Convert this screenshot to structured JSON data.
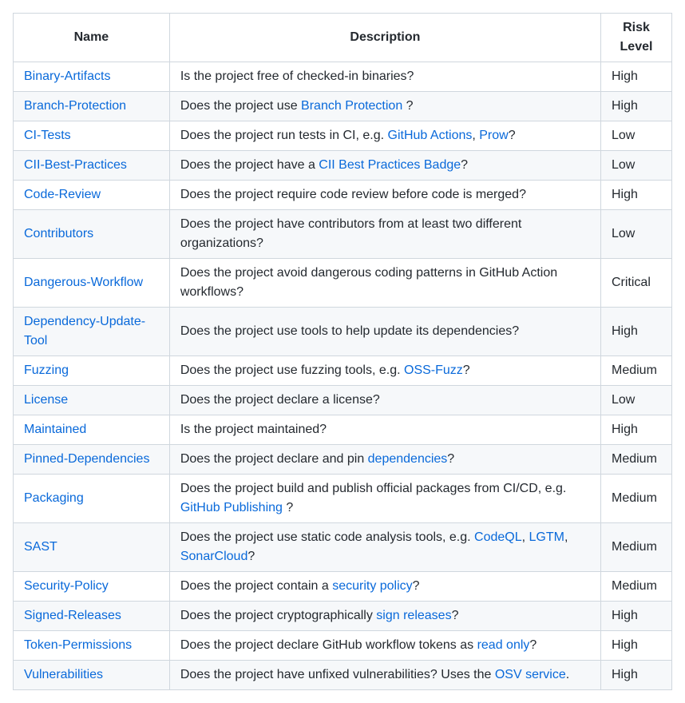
{
  "headers": {
    "name": "Name",
    "description": "Description",
    "risk": "Risk Level"
  },
  "rows": [
    {
      "name": "Binary-Artifacts",
      "desc": [
        {
          "t": "text",
          "v": "Is the project free of checked-in binaries?"
        }
      ],
      "risk": "High"
    },
    {
      "name": "Branch-Protection",
      "desc": [
        {
          "t": "text",
          "v": "Does the project use "
        },
        {
          "t": "link",
          "v": "Branch Protection"
        },
        {
          "t": "text",
          "v": " ?"
        }
      ],
      "risk": "High"
    },
    {
      "name": "CI-Tests",
      "desc": [
        {
          "t": "text",
          "v": "Does the project run tests in CI, e.g. "
        },
        {
          "t": "link",
          "v": "GitHub Actions"
        },
        {
          "t": "text",
          "v": ", "
        },
        {
          "t": "link",
          "v": "Prow"
        },
        {
          "t": "text",
          "v": "?"
        }
      ],
      "risk": "Low"
    },
    {
      "name": "CII-Best-Practices",
      "desc": [
        {
          "t": "text",
          "v": "Does the project have a "
        },
        {
          "t": "link",
          "v": "CII Best Practices Badge"
        },
        {
          "t": "text",
          "v": "?"
        }
      ],
      "risk": "Low"
    },
    {
      "name": "Code-Review",
      "desc": [
        {
          "t": "text",
          "v": "Does the project require code review before code is merged?"
        }
      ],
      "risk": "High"
    },
    {
      "name": "Contributors",
      "desc": [
        {
          "t": "text",
          "v": "Does the project have contributors from at least two different organizations?"
        }
      ],
      "risk": "Low"
    },
    {
      "name": "Dangerous-Workflow",
      "desc": [
        {
          "t": "text",
          "v": "Does the project avoid dangerous coding patterns in GitHub Action workflows?"
        }
      ],
      "risk": "Critical"
    },
    {
      "name": "Dependency-Update-Tool",
      "desc": [
        {
          "t": "text",
          "v": "Does the project use tools to help update its dependencies?"
        }
      ],
      "risk": "High"
    },
    {
      "name": "Fuzzing",
      "desc": [
        {
          "t": "text",
          "v": "Does the project use fuzzing tools, e.g. "
        },
        {
          "t": "link",
          "v": "OSS-Fuzz"
        },
        {
          "t": "text",
          "v": "?"
        }
      ],
      "risk": "Medium"
    },
    {
      "name": "License",
      "desc": [
        {
          "t": "text",
          "v": "Does the project declare a license?"
        }
      ],
      "risk": "Low"
    },
    {
      "name": "Maintained",
      "desc": [
        {
          "t": "text",
          "v": "Is the project maintained?"
        }
      ],
      "risk": "High"
    },
    {
      "name": "Pinned-Dependencies",
      "desc": [
        {
          "t": "text",
          "v": "Does the project declare and pin "
        },
        {
          "t": "link",
          "v": "dependencies"
        },
        {
          "t": "text",
          "v": "?"
        }
      ],
      "risk": "Medium"
    },
    {
      "name": "Packaging",
      "desc": [
        {
          "t": "text",
          "v": "Does the project build and publish official packages from CI/CD, e.g. "
        },
        {
          "t": "link",
          "v": "GitHub Publishing"
        },
        {
          "t": "text",
          "v": " ?"
        }
      ],
      "risk": "Medium"
    },
    {
      "name": "SAST",
      "desc": [
        {
          "t": "text",
          "v": "Does the project use static code analysis tools, e.g. "
        },
        {
          "t": "link",
          "v": "CodeQL"
        },
        {
          "t": "text",
          "v": ", "
        },
        {
          "t": "link",
          "v": "LGTM"
        },
        {
          "t": "text",
          "v": ", "
        },
        {
          "t": "link",
          "v": "SonarCloud"
        },
        {
          "t": "text",
          "v": "?"
        }
      ],
      "risk": "Medium"
    },
    {
      "name": "Security-Policy",
      "desc": [
        {
          "t": "text",
          "v": "Does the project contain a "
        },
        {
          "t": "link",
          "v": "security policy"
        },
        {
          "t": "text",
          "v": "?"
        }
      ],
      "risk": "Medium"
    },
    {
      "name": "Signed-Releases",
      "desc": [
        {
          "t": "text",
          "v": "Does the project cryptographically "
        },
        {
          "t": "link",
          "v": "sign releases"
        },
        {
          "t": "text",
          "v": "?"
        }
      ],
      "risk": "High"
    },
    {
      "name": "Token-Permissions",
      "desc": [
        {
          "t": "text",
          "v": "Does the project declare GitHub workflow tokens as "
        },
        {
          "t": "link",
          "v": "read only"
        },
        {
          "t": "text",
          "v": "?"
        }
      ],
      "risk": "High"
    },
    {
      "name": "Vulnerabilities",
      "desc": [
        {
          "t": "text",
          "v": "Does the project have unfixed vulnerabilities? Uses the "
        },
        {
          "t": "link",
          "v": "OSV service"
        },
        {
          "t": "text",
          "v": "."
        }
      ],
      "risk": "High"
    }
  ]
}
